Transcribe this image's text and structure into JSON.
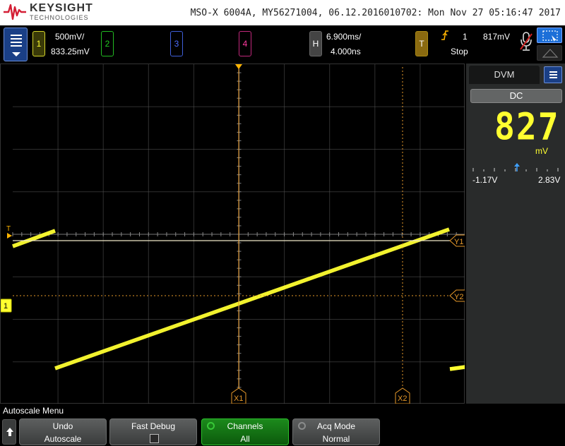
{
  "brand": {
    "name": "KEYSIGHT",
    "sub": "TECHNOLOGIES"
  },
  "instrument_info": "MSO-X 6004A, MY56271004, 06.12.2016010702: Mon Nov 27 05:16:47 2017",
  "channels": [
    {
      "label": "1",
      "scale": "500mV/",
      "offset": "833.25mV",
      "color": "#ffff30"
    },
    {
      "label": "2",
      "color": "#22cc22"
    },
    {
      "label": "3",
      "color": "#4c6cff"
    },
    {
      "label": "4",
      "color": "#ff3aa0"
    }
  ],
  "horizontal": {
    "label": "H",
    "timebase": "6.900ms/",
    "delay": "4.000ns"
  },
  "trigger": {
    "label": "T",
    "edge_icon": "rising-edge-icon",
    "source": "1",
    "level": "817mV",
    "status": "Stop"
  },
  "plot": {
    "trigger_marker": "T",
    "ground_marker": "1",
    "cursor_y1": "Y1",
    "cursor_y2": "Y2",
    "cursor_x1": "X1",
    "cursor_x2": "X2",
    "colors": {
      "trace": "#ffff30",
      "grid": "#555555",
      "cursor": "#e89a2a"
    }
  },
  "dvm": {
    "tab": "DVM",
    "mode": "DC",
    "value": "827",
    "unit": "mV",
    "range_min": "-1.17V",
    "range_max": "2.83V"
  },
  "softkeys": {
    "menu_title": "Autoscale Menu",
    "keys": [
      {
        "line1": "Undo",
        "line2": "Autoscale"
      },
      {
        "line1": "Fast Debug",
        "line2": ""
      },
      {
        "line1": "Channels",
        "line2": "All"
      },
      {
        "line1": "Acq Mode",
        "line2": "Normal"
      }
    ]
  }
}
